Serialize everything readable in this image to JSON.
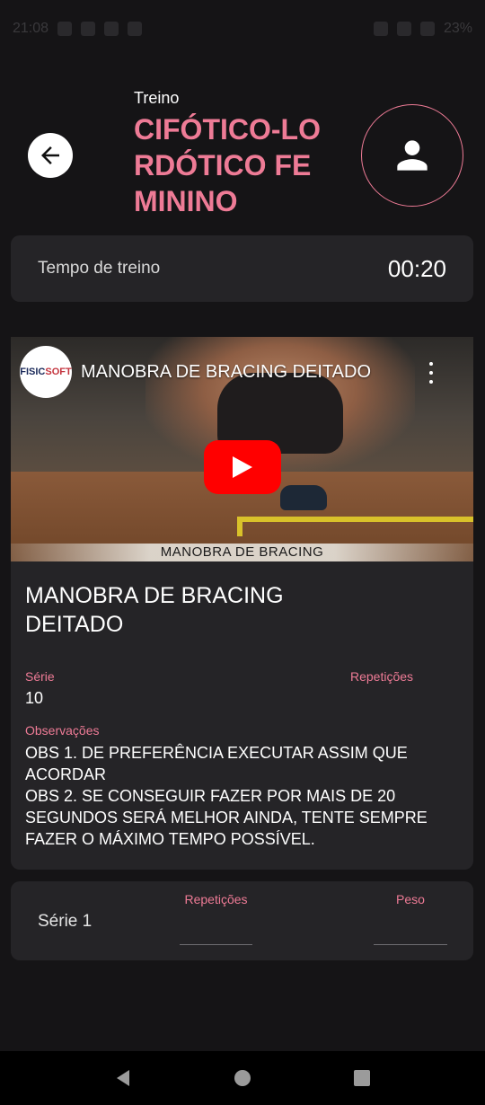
{
  "status_bar": {
    "time": "21:08",
    "battery": "23%"
  },
  "header": {
    "subtitle": "Treino",
    "title": "CIFÓTICO-LORDÓTICO FEMININO",
    "accent_color": "#ee7b96",
    "back_icon": "arrow-left-icon",
    "profile_icon": "person-icon"
  },
  "timer": {
    "label": "Tempo de treino",
    "value": "00:20"
  },
  "video": {
    "channel_logo_text": "FISIC",
    "channel_logo_text_accent": "SOFT",
    "title": "MANOBRA DE BRACING DEITADO",
    "caption": "MANOBRA DE BRACING",
    "play_icon": "youtube-play-icon",
    "menu_icon": "more-vertical-icon"
  },
  "exercise": {
    "name": "MANOBRA DE BRACING DEITADO",
    "serie_label": "Série",
    "serie_value": "10",
    "repeticoes_label": "Repetições",
    "repeticoes_value": "",
    "obs_label": "Observações",
    "obs_text": "OBS 1. DE PREFERÊNCIA EXECUTAR ASSIM QUE ACORDAR\nOBS 2. SE CONSEGUIR FAZER POR MAIS DE 20 SEGUNDOS SERÁ MELHOR AINDA, TENTE SEMPRE FAZER O MÁXIMO TEMPO POSSÍVEL."
  },
  "series": [
    {
      "label": "Série 1",
      "reps_label": "Repetições",
      "reps_value": "",
      "peso_label": "Peso",
      "peso_value": ""
    }
  ],
  "nav": {
    "back_icon": "triangle-back-icon",
    "home_icon": "circle-home-icon",
    "recents_icon": "square-recents-icon"
  }
}
